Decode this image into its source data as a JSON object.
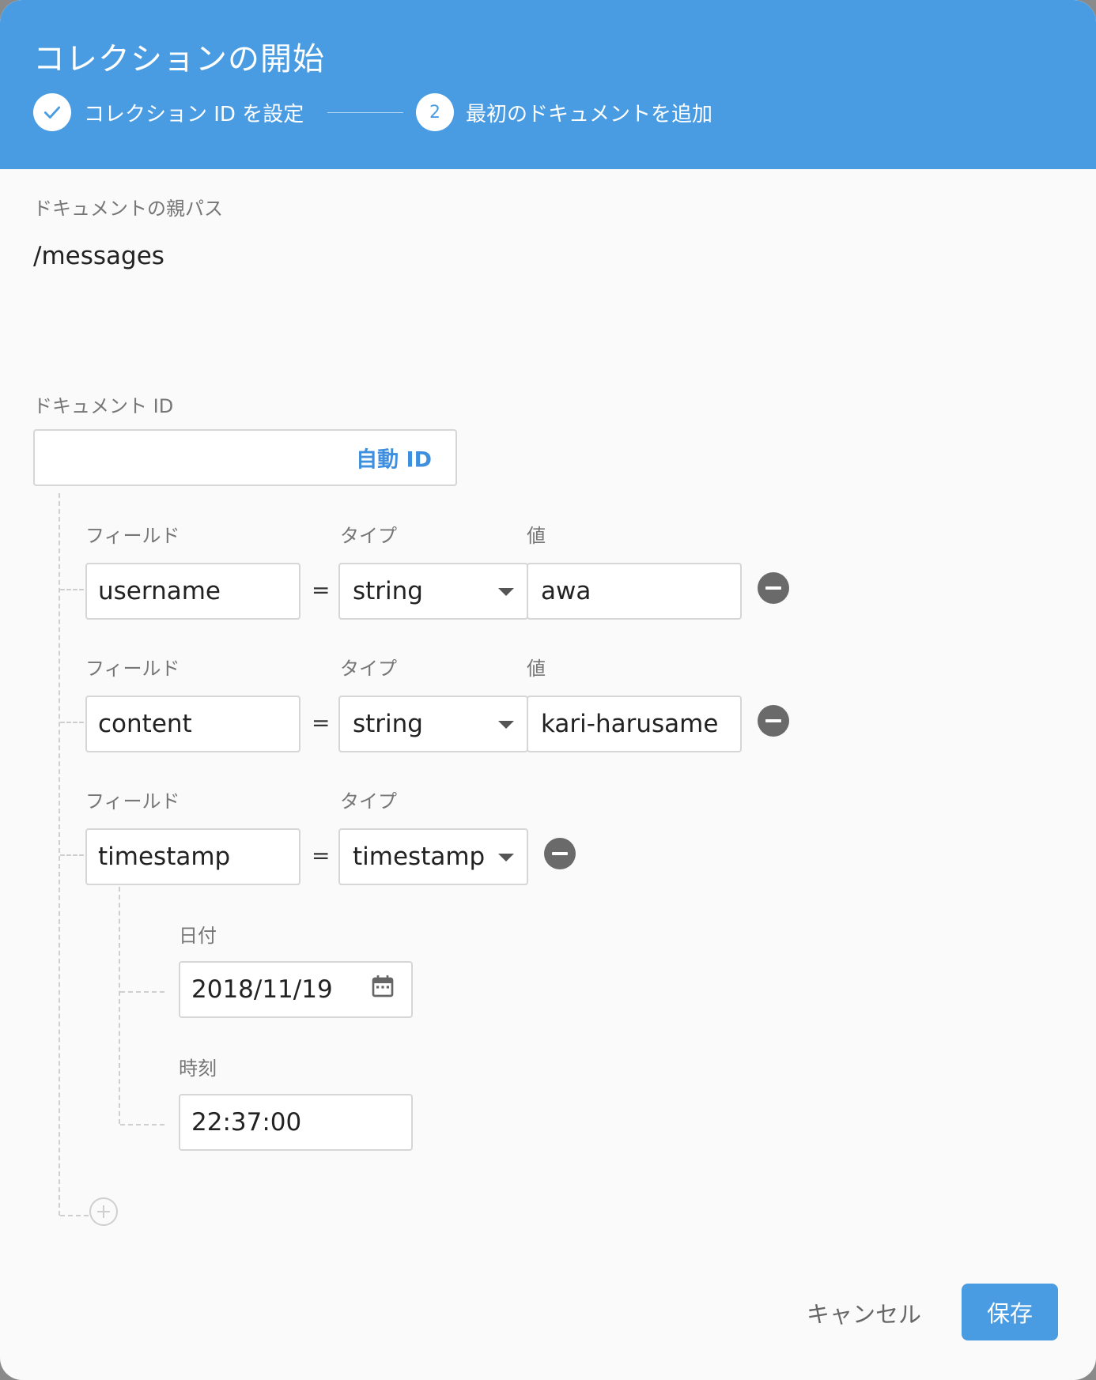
{
  "header": {
    "title": "コレクションの開始",
    "step1_label": "コレクション ID を設定",
    "step2_number": "2",
    "step2_label": "最初のドキュメントを追加"
  },
  "parent_path": {
    "label": "ドキュメントの親パス",
    "value": "/messages"
  },
  "document_id": {
    "label": "ドキュメント ID",
    "value": "",
    "auto_id_label": "自動 ID"
  },
  "field_headers": {
    "field": "フィールド",
    "type": "タイプ",
    "value": "値"
  },
  "fields": [
    {
      "name": "username",
      "type": "string",
      "value": "awa"
    },
    {
      "name": "content",
      "type": "string",
      "value": "kari-harusame"
    },
    {
      "name": "timestamp",
      "type": "timestamp"
    }
  ],
  "equals_sign": "=",
  "timestamp": {
    "date_label": "日付",
    "date_value": "2018/11/19",
    "time_label": "時刻",
    "time_value": "22:37:00"
  },
  "footer": {
    "cancel_label": "キャンセル",
    "save_label": "保存"
  },
  "colors": {
    "header_bg": "#4a9ce2",
    "accent": "#3f8fdf"
  },
  "icons": [
    "check-icon",
    "chevron-down-icon",
    "remove-circle-icon",
    "calendar-icon",
    "add-circle-icon"
  ]
}
